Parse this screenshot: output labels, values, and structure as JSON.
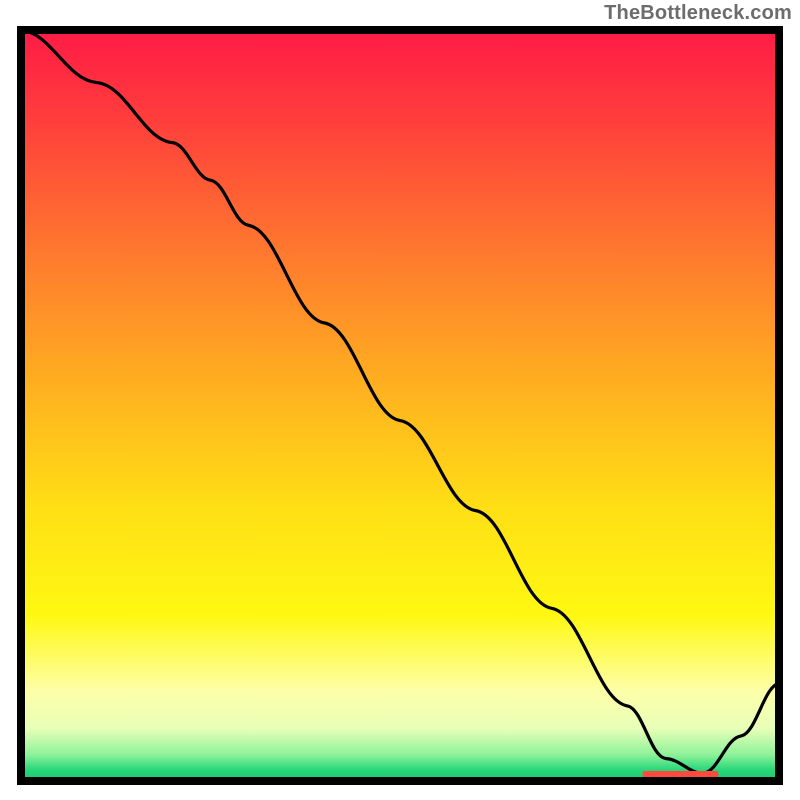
{
  "attribution": "TheBottleneck.com",
  "chart_data": {
    "type": "line",
    "title": "",
    "xlabel": "",
    "ylabel": "",
    "xlim": [
      0,
      100
    ],
    "ylim": [
      0,
      100
    ],
    "x": [
      0,
      10,
      20,
      25,
      30,
      40,
      50,
      60,
      70,
      80,
      85,
      90,
      95,
      100
    ],
    "values": [
      100,
      93,
      85,
      80,
      74,
      61,
      48,
      36,
      23,
      10,
      3,
      1,
      6,
      13
    ],
    "series": [
      {
        "name": "curve",
        "values": [
          100,
          93,
          85,
          80,
          74,
          61,
          48,
          36,
          23,
          10,
          3,
          1,
          6,
          13
        ]
      }
    ],
    "optimum_marker_x_range": [
      82,
      92
    ],
    "background_gradient_stops": [
      {
        "offset": 0.0,
        "color": "#ff1b46"
      },
      {
        "offset": 0.12,
        "color": "#ff3e3c"
      },
      {
        "offset": 0.3,
        "color": "#ff7a2e"
      },
      {
        "offset": 0.48,
        "color": "#ffb21f"
      },
      {
        "offset": 0.64,
        "color": "#ffe015"
      },
      {
        "offset": 0.78,
        "color": "#fff812"
      },
      {
        "offset": 0.88,
        "color": "#fdffa8"
      },
      {
        "offset": 0.93,
        "color": "#e8ffb8"
      },
      {
        "offset": 0.965,
        "color": "#8ef29a"
      },
      {
        "offset": 0.985,
        "color": "#29d77a"
      },
      {
        "offset": 1.0,
        "color": "#17c86d"
      }
    ]
  }
}
